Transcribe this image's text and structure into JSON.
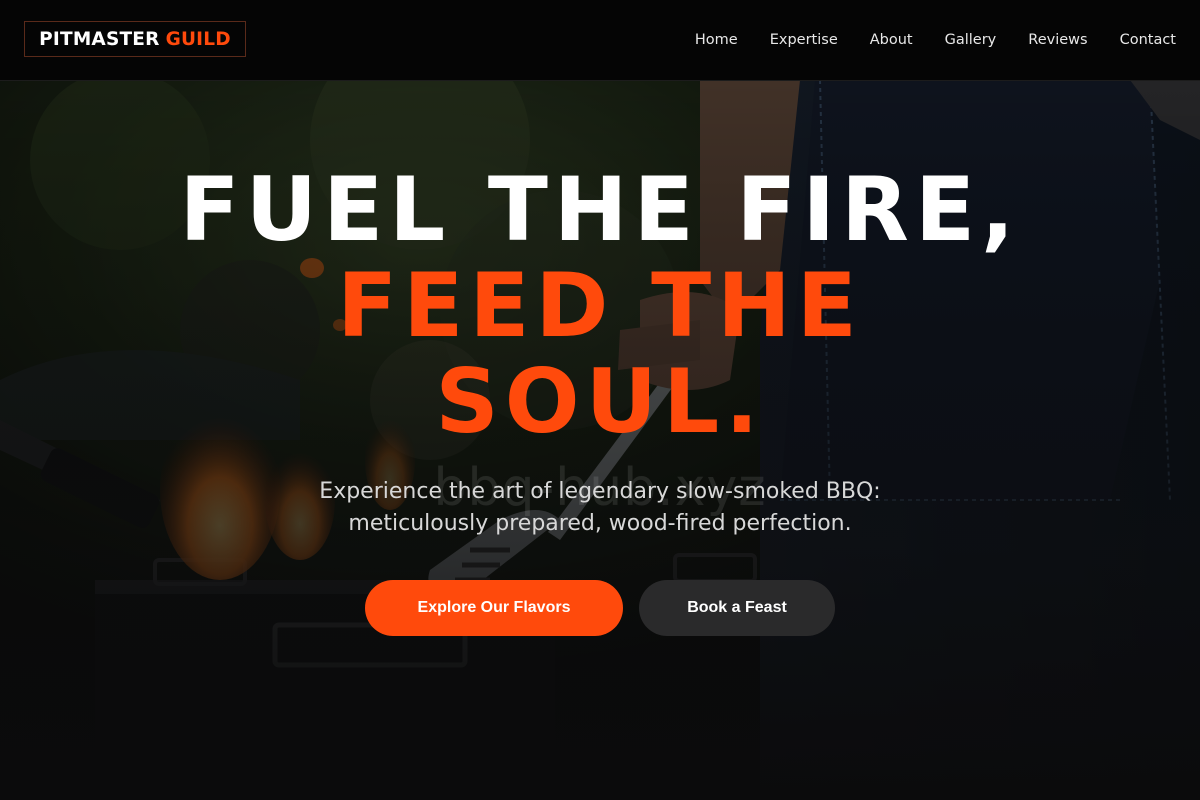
{
  "brand": {
    "part1": "PITMASTER",
    "part2": "GUILD",
    "accent_color": "#ff4a0c"
  },
  "nav": {
    "items": [
      {
        "label": "Home"
      },
      {
        "label": "Expertise"
      },
      {
        "label": "About"
      },
      {
        "label": "Gallery"
      },
      {
        "label": "Reviews"
      },
      {
        "label": "Contact"
      }
    ]
  },
  "hero": {
    "line1": "FUEL THE FIRE,",
    "line2": "FEED THE",
    "line3": "SOUL.",
    "watermark": "bbq-hub.xyz",
    "subtitle_line1": "Experience the art of legendary slow-smoked BBQ:",
    "subtitle_line2": "meticulously prepared, wood-fired perfection.",
    "primary_cta": "Explore Our Flavors",
    "secondary_cta": "Book a Feast",
    "background_image": "pitmaster-grilling-icon"
  }
}
